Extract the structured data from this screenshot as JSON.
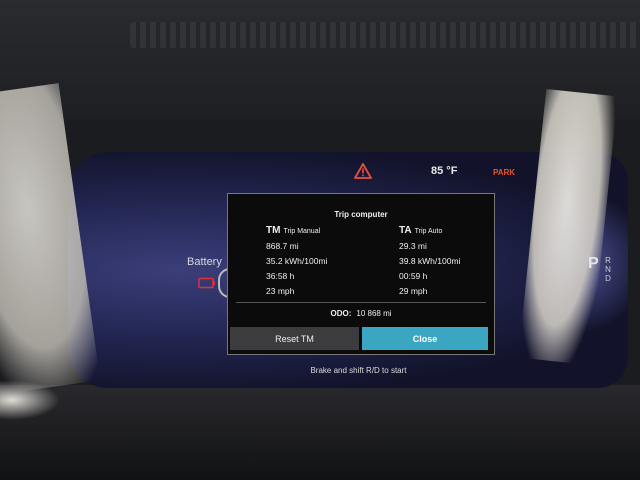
{
  "status_bar": {
    "warning_icon": "warning-triangle-icon",
    "outside_temp": "85 °F",
    "park_indicator": "PARK",
    "park_color": "#e25535"
  },
  "battery": {
    "label": "Battery",
    "icon": "battery-icon",
    "icon_color": "#e0303a"
  },
  "gear_selector": {
    "current": "P",
    "options": [
      "R",
      "N",
      "D"
    ]
  },
  "trip_computer": {
    "title": "Trip computer",
    "manual": {
      "abbr": "TM",
      "name": "Trip Manual",
      "distance": "868.7 mi",
      "consumption": "35.2 kWh/100mi",
      "time": "36:58 h",
      "speed": "23 mph"
    },
    "auto": {
      "abbr": "TA",
      "name": "Trip Auto",
      "distance": "29.3 mi",
      "consumption": "39.8 kWh/100mi",
      "time": "00:59 h",
      "speed": "29 mph"
    },
    "odometer": {
      "label": "ODO:",
      "value": "10 868 mi"
    },
    "buttons": {
      "reset_label": "Reset TM",
      "close_label": "Close"
    },
    "accent_color": "#3aa6c2"
  },
  "start_hint": "Brake and shift R/D to start"
}
